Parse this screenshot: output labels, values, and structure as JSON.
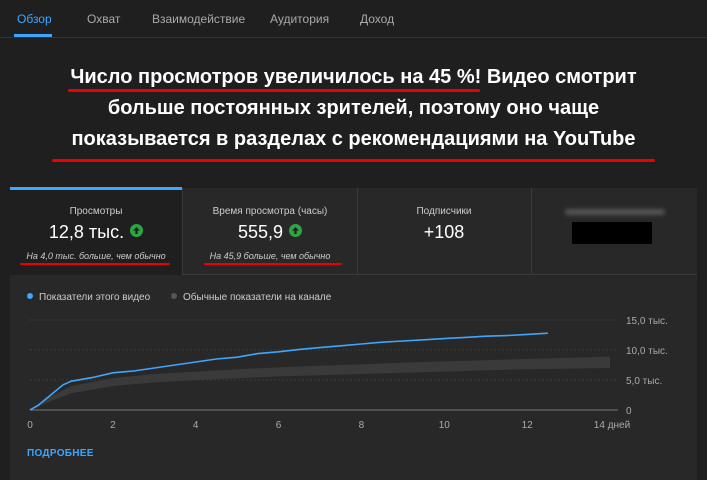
{
  "tabs": [
    {
      "label": "Обзор",
      "active": true
    },
    {
      "label": "Охват",
      "active": false
    },
    {
      "label": "Взаимодействие",
      "active": false
    },
    {
      "label": "Аудитория",
      "active": false
    },
    {
      "label": "Доход",
      "active": false
    }
  ],
  "banner": {
    "line1_highlight": "Число просмотров увеличилось на 45 %!",
    "line1_rest": " Видео смотрит",
    "line2": "больше постоянных зрителей, поэтому оно чаще",
    "line3": "показывается в разделах с рекомендациями на YouTube"
  },
  "metrics": [
    {
      "label": "Просмотры",
      "value": "12,8 тыс.",
      "note": "На 4,0 тыс. больше, чем обычно",
      "trend": "up"
    },
    {
      "label": "Время просмотра (часы)",
      "value": "555,9",
      "note": "На 45,9 больше, чем обычно",
      "trend": "up"
    },
    {
      "label": "Подписчики",
      "value": "+108",
      "note": "",
      "trend": ""
    }
  ],
  "legend": {
    "this_video": "Показатели этого видео",
    "channel_typical": "Обычные показатели на канале"
  },
  "colors": {
    "accent": "#3ea6ff",
    "up_badge": "#2ba640",
    "highlight_underline": "#ee0000",
    "band": "#3a3a3a"
  },
  "chart_data": {
    "type": "area",
    "x_unit_label": "14 дней",
    "xlim": [
      0,
      14
    ],
    "ylim": [
      0,
      15000
    ],
    "x_ticks": [
      "0",
      "2",
      "4",
      "6",
      "8",
      "10",
      "12"
    ],
    "y_ticks": [
      "0",
      "5,0 тыс.",
      "10,0 тыс.",
      "15,0 тыс."
    ],
    "y_tick_values": [
      0,
      5000,
      10000,
      15000
    ],
    "series": [
      {
        "name": "Показатели этого видео",
        "x": [
          0,
          0.2,
          0.5,
          0.8,
          1,
          1.5,
          2,
          2.5,
          3,
          3.5,
          4,
          4.5,
          5,
          5.5,
          6,
          6.5,
          7,
          7.5,
          8,
          8.5,
          9,
          9.5,
          10,
          10.5,
          11,
          11.5,
          12,
          12.5
        ],
        "y": [
          0,
          800,
          2500,
          4200,
          4800,
          5400,
          6200,
          6500,
          7000,
          7500,
          8000,
          8500,
          8800,
          9400,
          9700,
          10100,
          10400,
          10700,
          11000,
          11300,
          11500,
          11700,
          11900,
          12100,
          12300,
          12400,
          12600,
          12800
        ]
      },
      {
        "name": "Обычные показатели на канале",
        "x": [
          0,
          0.5,
          1,
          2,
          3,
          4,
          5,
          6,
          7,
          8,
          9,
          10,
          11,
          12,
          13,
          14
        ],
        "low": [
          0,
          1500,
          2800,
          4000,
          4600,
          5000,
          5300,
          5600,
          5800,
          6000,
          6200,
          6400,
          6600,
          6800,
          6900,
          7000
        ],
        "high": [
          0,
          2300,
          4000,
          5300,
          6000,
          6400,
          6800,
          7100,
          7400,
          7600,
          7900,
          8100,
          8300,
          8500,
          8700,
          8900
        ]
      }
    ]
  },
  "more_link": "ПОДРОБНЕЕ"
}
